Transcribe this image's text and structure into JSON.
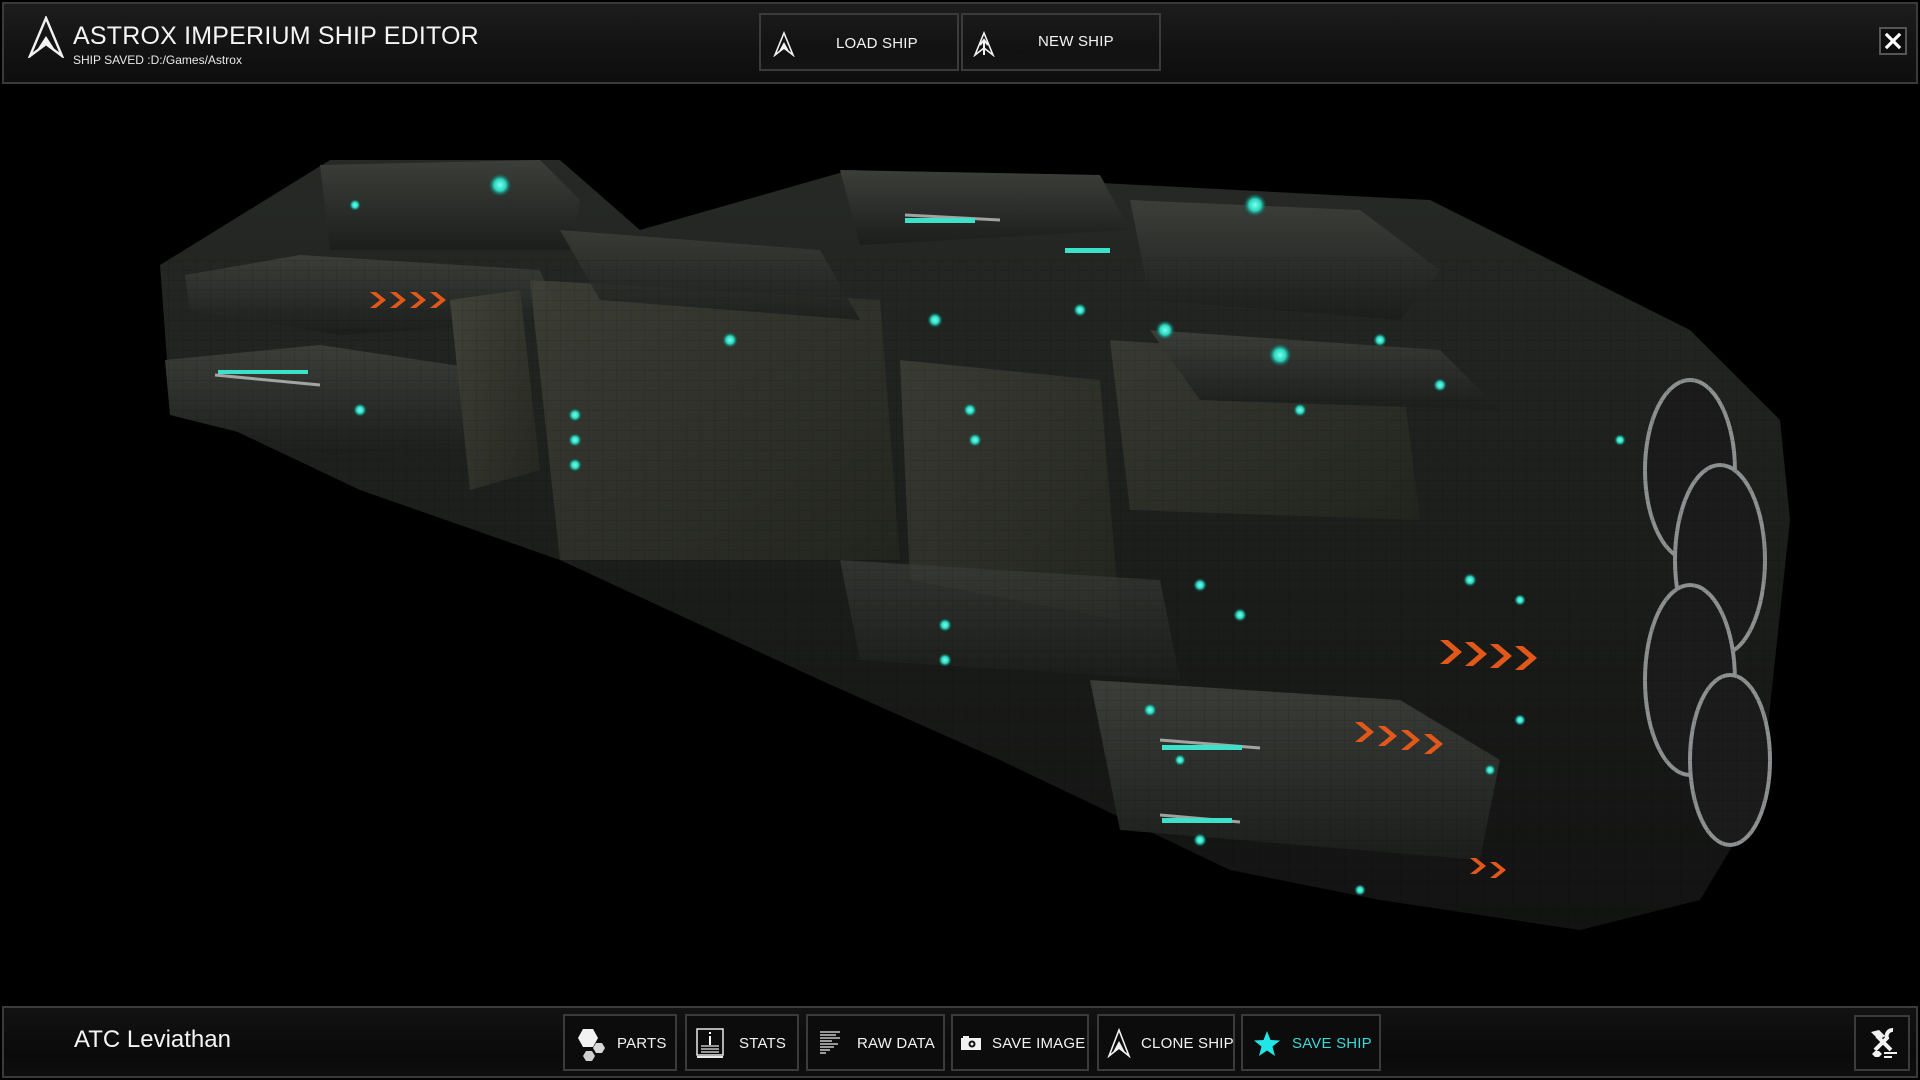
{
  "header": {
    "title": "ASTROX IMPERIUM SHIP EDITOR",
    "subtitle": "SHIP SAVED :D:/Games/Astrox",
    "logo_icon": "astrox-arrow-logo-icon",
    "buttons": [
      {
        "label": "LOAD SHIP",
        "icon": "astrox-arrow-icon"
      },
      {
        "label": "NEW SHIP",
        "icon": "astrox-arrow-plus-icon"
      }
    ],
    "close_icon": "close-icon"
  },
  "viewport": {
    "subject": "3D ship model",
    "ship_model_name": "ATC Leviathan",
    "colors": {
      "background": "#000000",
      "hull_dark": "#1a1c1b",
      "hull_mid": "#2d302c",
      "hull_light": "#4a4d46",
      "panel_olive": "#3f3f33",
      "light_cyan": "#3de0c8",
      "chevron_orange": "#e2581a",
      "trim_white": "#c8cccc"
    }
  },
  "footer": {
    "ship_name": "ATC Leviathan",
    "buttons": [
      {
        "label": "PARTS",
        "icon": "hexagons-icon"
      },
      {
        "label": "STATS",
        "icon": "info-stats-icon"
      },
      {
        "label": "RAW DATA",
        "icon": "text-lines-icon"
      },
      {
        "label": "SAVE IMAGE",
        "icon": "camera-icon"
      },
      {
        "label": "CLONE SHIP",
        "icon": "astrox-arrow-icon"
      },
      {
        "label": "SAVE SHIP",
        "icon": "star-icon",
        "active": true
      }
    ],
    "tools_icon": "tools-icon",
    "accent_color": "#22e6e6"
  }
}
